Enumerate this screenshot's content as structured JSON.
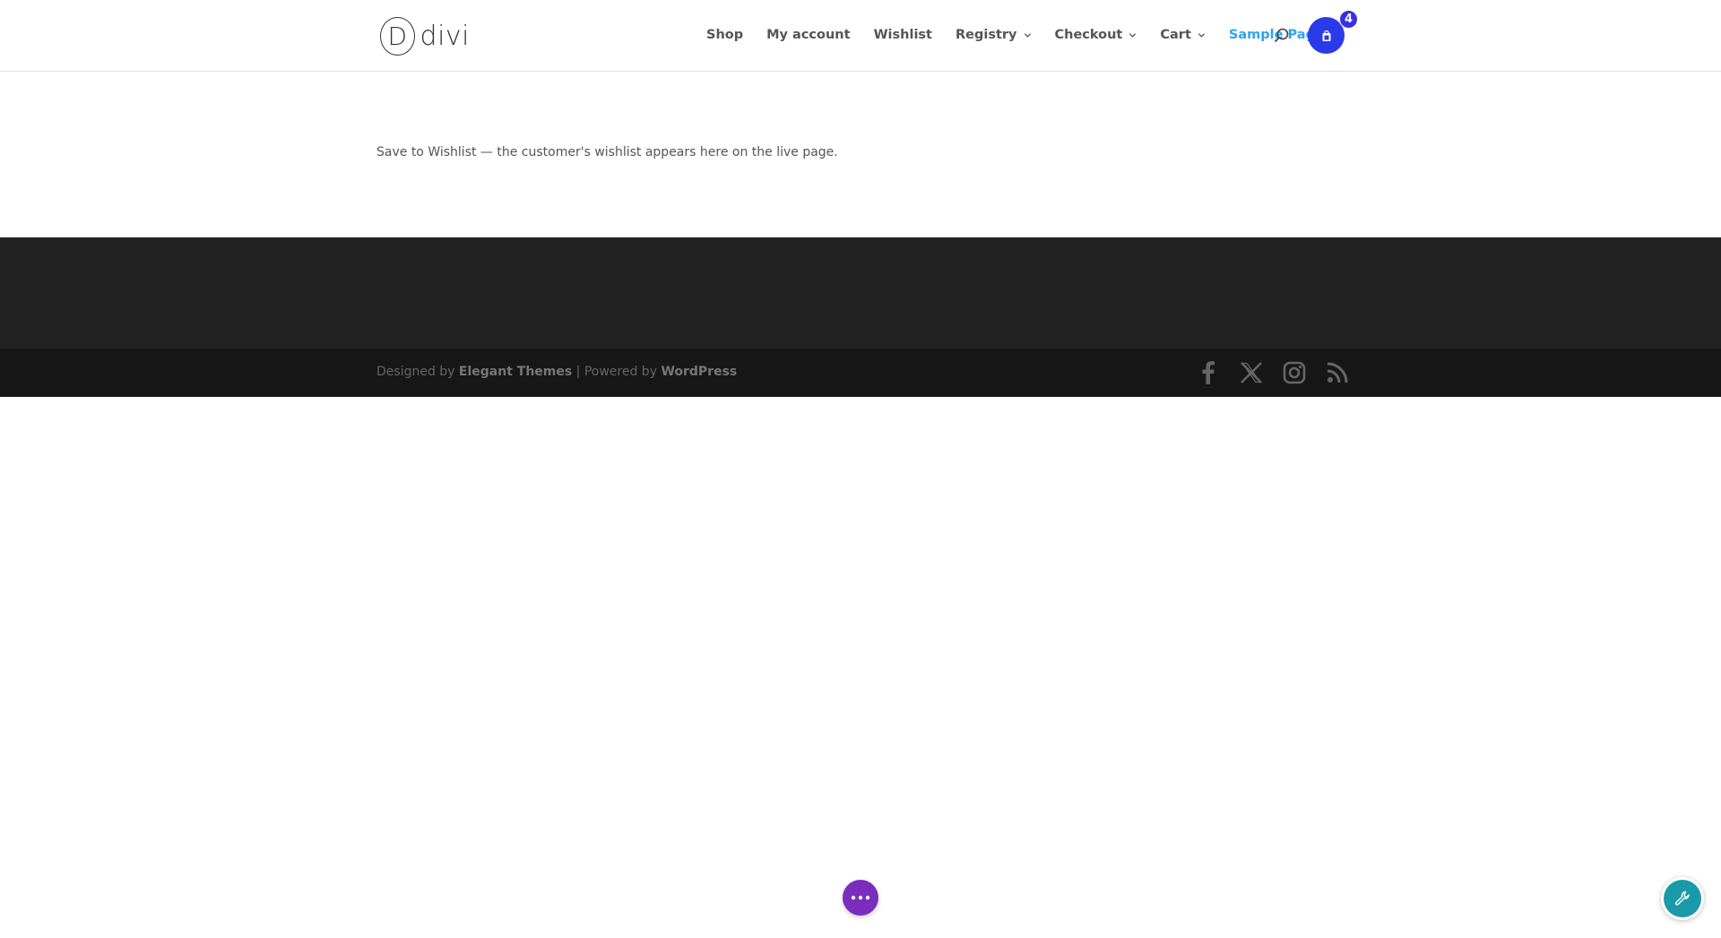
{
  "header": {
    "logo": {
      "mark": "D",
      "text": "divi"
    },
    "nav": [
      {
        "label": "Shop",
        "dropdown": false
      },
      {
        "label": "My account",
        "dropdown": false
      },
      {
        "label": "Wishlist",
        "dropdown": false
      },
      {
        "label": "Registry",
        "dropdown": true
      },
      {
        "label": "Checkout",
        "dropdown": true
      },
      {
        "label": "Cart",
        "dropdown": true
      },
      {
        "label": "Sample Page",
        "dropdown": false,
        "active": true
      }
    ],
    "search_icon": "search-icon",
    "cart": {
      "icon": "shopping-bag-icon",
      "count": "4",
      "color": "#2b3ae8"
    }
  },
  "main": {
    "text": "Save to Wishlist — the customer's wishlist appears here on the live page."
  },
  "footer": {
    "credits_prefix": "Designed by ",
    "credits_brand": "Elegant Themes",
    "credits_sep": " | Powered by ",
    "credits_platform": "WordPress",
    "socials": [
      "facebook-icon",
      "x-icon",
      "instagram-icon",
      "rss-icon"
    ]
  },
  "floating": {
    "dots_button_color": "#7b2dbd",
    "tool_button_color": "#1a9aa8"
  },
  "colors": {
    "accent": "#2ea3f2",
    "footer_top": "#222222",
    "footer_bottom": "#171717"
  }
}
